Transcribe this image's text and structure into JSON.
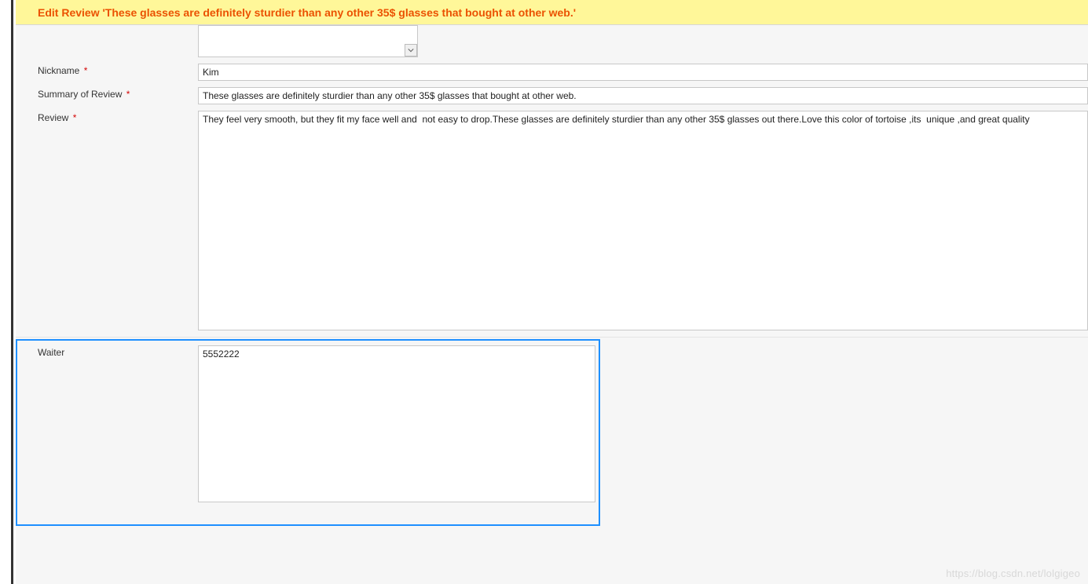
{
  "header": {
    "title": "Edit Review 'These glasses are definitely sturdier than any other 35$ glasses that bought at other web.'"
  },
  "form": {
    "select_placeholder": "",
    "nickname": {
      "label": "Nickname",
      "required": "*",
      "value": "Kim"
    },
    "summary": {
      "label": "Summary of Review",
      "required": "*",
      "value": "These glasses are definitely sturdier than any other 35$ glasses that bought at other web."
    },
    "review": {
      "label": "Review",
      "required": "*",
      "value": "They feel very smooth, but they fit my face well and  not easy to drop.These glasses are definitely sturdier than any other 35$ glasses out there.Love this color of tortoise ,its  unique ,and great quality"
    },
    "waiter": {
      "label": "Waiter",
      "required": "",
      "value": "5552222"
    }
  },
  "watermark": "https://blog.csdn.net/lolgigeo"
}
